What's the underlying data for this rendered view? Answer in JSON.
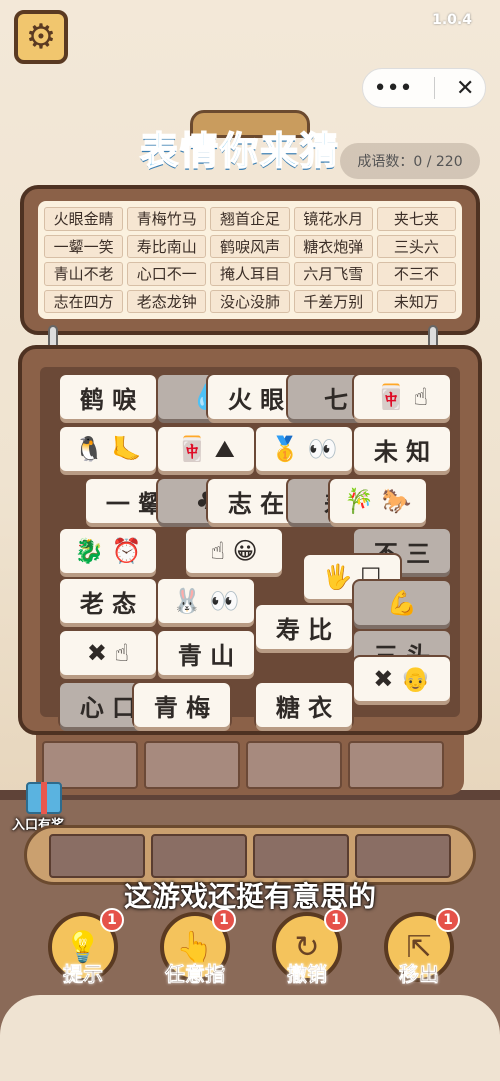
{
  "status": {
    "version": "1.0.4"
  },
  "title": "表情你来猜",
  "progress": "成语数：0 / 220",
  "idioms": [
    "火眼金睛",
    "青梅竹马",
    "翘首企足",
    "镜花水月",
    "夹七夹",
    "一颦一笑",
    "寿比南山",
    "鹤唳风声",
    "糖衣炮弹",
    "三头六",
    "青山不老",
    "心口不一",
    "掩人耳目",
    "六月飞雪",
    "不三不",
    "志在四方",
    "老态龙钟",
    "没心没肺",
    "千差万别",
    "未知万"
  ],
  "tiles": [
    {
      "id": "t1",
      "text": "鹤 唳",
      "icons": "",
      "dim": false
    },
    {
      "id": "t2",
      "text": "",
      "icons": "💧",
      "dim": true
    },
    {
      "id": "t3",
      "text": "火 眼",
      "icons": "",
      "dim": false
    },
    {
      "id": "t4",
      "text": "七",
      "icons": "",
      "dim": true
    },
    {
      "id": "t5",
      "text": "",
      "icons": "🀄 ☝",
      "dim": false
    },
    {
      "id": "t6",
      "text": "",
      "icons": "🐧 🦶",
      "dim": false
    },
    {
      "id": "t7",
      "text": "",
      "icons": "🀄 ⛰",
      "dim": false
    },
    {
      "id": "t8",
      "text": "",
      "icons": "🥇 👀",
      "dim": false
    },
    {
      "id": "t9",
      "text": "未 知",
      "icons": "",
      "dim": false
    },
    {
      "id": "t10",
      "text": "一 颦",
      "icons": "",
      "dim": false
    },
    {
      "id": "t11",
      "text": "",
      "icons": "♣",
      "dim": true
    },
    {
      "id": "t12",
      "text": "志 在",
      "icons": "",
      "dim": false
    },
    {
      "id": "t13",
      "text": "差",
      "icons": "",
      "dim": true
    },
    {
      "id": "t14",
      "text": "",
      "icons": "🎋 🐎",
      "dim": false
    },
    {
      "id": "t15",
      "text": "",
      "icons": "🐉 ⏰",
      "dim": false
    },
    {
      "id": "t16",
      "text": "",
      "icons": "☝ 😀",
      "dim": false
    },
    {
      "id": "t17",
      "text": "不 三",
      "icons": "",
      "dim": true
    },
    {
      "id": "t18",
      "text": "",
      "icons": "🖐 ☐",
      "dim": false
    },
    {
      "id": "t19",
      "text": "老 态",
      "icons": "",
      "dim": false
    },
    {
      "id": "t20",
      "text": "",
      "icons": "🐰 👀",
      "dim": false
    },
    {
      "id": "t21",
      "text": "",
      "icons": "💪",
      "dim": true
    },
    {
      "id": "t22",
      "text": "寿 比",
      "icons": "",
      "dim": false
    },
    {
      "id": "t23",
      "text": "",
      "icons": "✖ ☝",
      "dim": false
    },
    {
      "id": "t24",
      "text": "青 山",
      "icons": "",
      "dim": false
    },
    {
      "id": "t25",
      "text": "三 头",
      "icons": "",
      "dim": true
    },
    {
      "id": "t26",
      "text": "",
      "icons": "✖ 👴",
      "dim": false
    },
    {
      "id": "t27",
      "text": "心 口",
      "icons": "",
      "dim": true
    },
    {
      "id": "t28",
      "text": "青 梅",
      "icons": "",
      "dim": false
    },
    {
      "id": "t29",
      "text": "糖 衣",
      "icons": "",
      "dim": false
    }
  ],
  "gift_label": "入口有奖",
  "caption": "这游戏还挺有意思的",
  "actions": [
    {
      "label": "提示",
      "icon": "💡",
      "badge": "1"
    },
    {
      "label": "任意指",
      "icon": "👆",
      "badge": "1"
    },
    {
      "label": "撤销",
      "icon": "↻",
      "badge": "1"
    },
    {
      "label": "移出",
      "icon": "⇱",
      "badge": "1"
    }
  ]
}
